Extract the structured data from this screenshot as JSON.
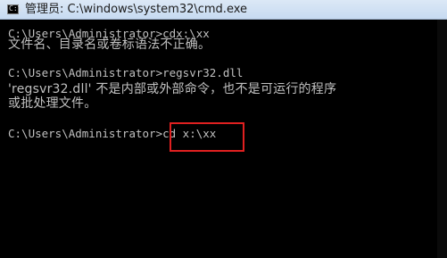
{
  "window": {
    "title": "管理员: C:\\windows\\system32\\cmd.exe",
    "icon": "cmd-icon",
    "icon_glyph": "C:\\"
  },
  "console": {
    "lines": [
      "C:\\Users\\Administrator>cdx:\\xx",
      "文件名、目录名或卷标语法不正确。",
      "C:\\Users\\Administrator>regsvr32.dll",
      "'regsvr32.dll' 不是内部或外部命令，也不是可运行的程序",
      "或批处理文件。",
      "C:\\Users\\Administrator>cd x:\\xx"
    ]
  },
  "colors": {
    "console_background": "#000000",
    "console_text": "#c0c0c0",
    "highlight": "#e02020"
  }
}
